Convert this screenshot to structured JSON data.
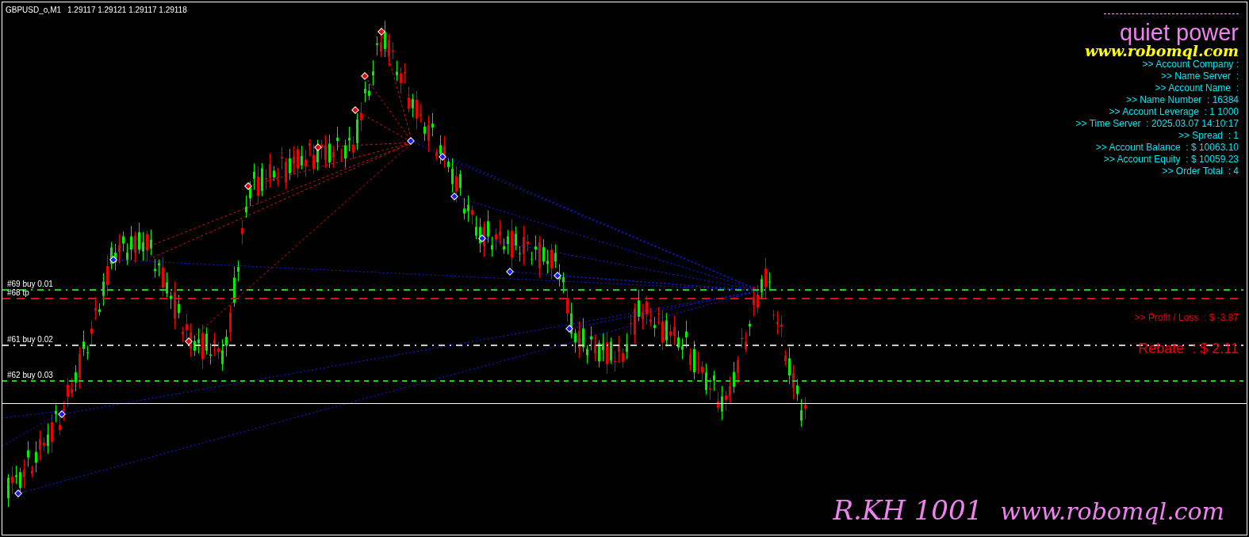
{
  "chart": {
    "symbol": "GBPUSD_o,M1",
    "prices": "1.29117 1.29121 1.29117 1.29118"
  },
  "panel": {
    "title": "quiet power",
    "website": "www.robomql.com",
    "lines": [
      ">> Account Company :",
      ">> Name Server  :",
      ">> Account Name  :",
      ">> Name Number  : 16384",
      ">> Account Leverage  : 1 1000",
      ">> Time Server  : 2025.03.07 14:10:17",
      ">> Spread  : 1",
      ">> Account Balance  : $ 10063.10",
      ">> Account Equity  : $ 10059.23",
      ">> Order Total  : 4"
    ]
  },
  "orders": [
    {
      "label": "#69 buy 0.01",
      "color": "#22cc22"
    },
    {
      "label": "#68 tp",
      "color": "#dd1111"
    },
    {
      "label": "#61 buy 0.02",
      "color": "#cccccc"
    },
    {
      "label": "#62 buy 0.03",
      "color": "#22cc22"
    }
  ],
  "profit_loss": ">> Profit / Loss  : $ -3.87",
  "rebate": "Rebate  : $ 2.11",
  "footer": {
    "code": "R.KH 1001",
    "website": "www.robomql.com"
  }
}
